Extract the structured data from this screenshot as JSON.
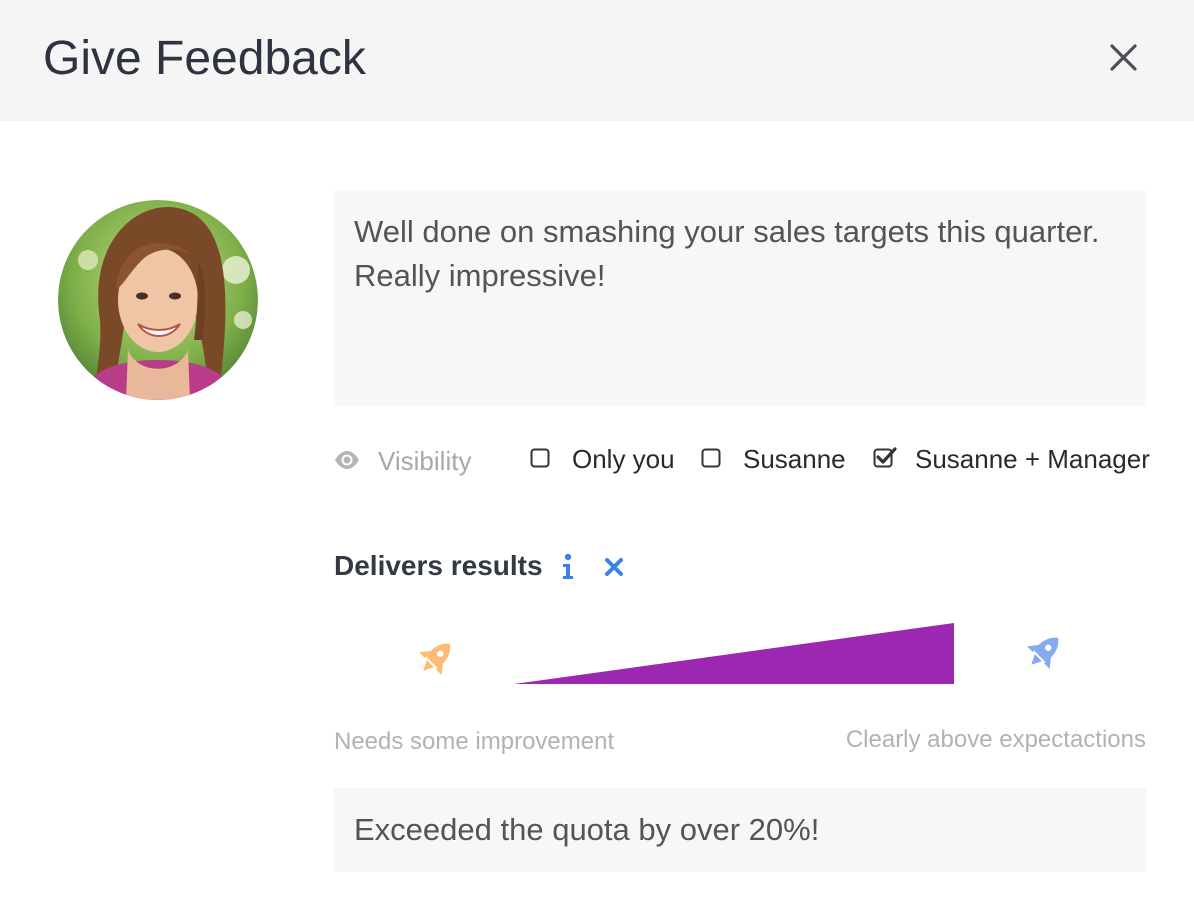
{
  "dialog": {
    "title": "Give Feedback",
    "close_icon": "close-icon"
  },
  "recipient": {
    "avatar_icon": "avatar-photo"
  },
  "feedback": {
    "text": "Well done on smashing your sales targets this quarter.\nReally impressive!"
  },
  "visibility": {
    "icon": "eye-icon",
    "label": "Visibility",
    "options": [
      {
        "label": "Only you",
        "checked": false
      },
      {
        "label": "Susanne",
        "checked": false
      },
      {
        "label": "Susanne + Manager",
        "checked": true
      }
    ]
  },
  "competency": {
    "title": "Delivers results",
    "info_icon": "info-icon",
    "remove_icon": "remove-icon",
    "rating": 1.0,
    "scale_low_label": "Needs some improvement",
    "scale_high_label": "Clearly above expectactions",
    "low_icon": "rocket-icon",
    "high_icon": "rocket-icon",
    "comment": "Exceeded the quota by over 20%!"
  },
  "colors": {
    "header_bg": "#f5f5f5",
    "slider_fill": "#9c27b0",
    "accent_blue": "#3b82e6",
    "rocket_low": "#fdbb73",
    "rocket_high": "#86a9ef"
  }
}
